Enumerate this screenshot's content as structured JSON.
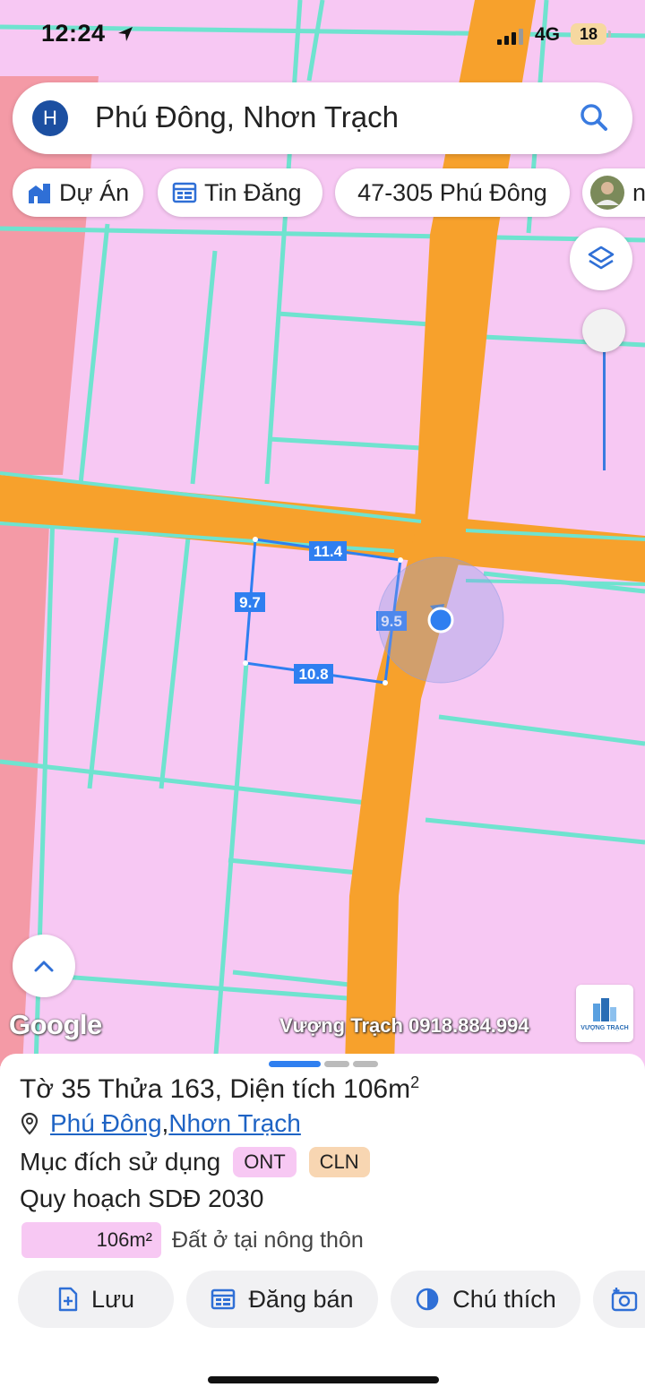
{
  "status": {
    "time": "12:24",
    "network": "4G",
    "battery": "18"
  },
  "search": {
    "avatar_letter": "H",
    "query": "Phú Đông, Nhơn Trạch"
  },
  "chips": [
    {
      "label": "Dự Án",
      "icon": "building-icon"
    },
    {
      "label": "Tin Đăng",
      "icon": "listing-icon"
    },
    {
      "label": "47-305 Phú Đông",
      "icon": ""
    },
    {
      "label": "n",
      "icon": "avatar-photo"
    }
  ],
  "map": {
    "edge_labels": [
      "11.4",
      "9.7",
      "9.5",
      "10.8"
    ],
    "google_logo": "Google",
    "watermark": "Vượng Trạch 0918.884.994",
    "watermark_logo_text": "VƯỢNG TRẠCH"
  },
  "sheet": {
    "title_prefix": "Tờ 35 Thửa 163, Diện tích 106m",
    "title_sup": "2",
    "location_ward": "Phú Đông",
    "location_sep": ", ",
    "location_district": "Nhơn Trạch",
    "purpose_label": "Mục đích sử dụng",
    "purpose_tags": [
      "ONT",
      "CLN"
    ],
    "plan_title": "Quy hoạch SDĐ 2030",
    "plan_area": "106m²",
    "plan_desc": "Đất ở tại nông thôn",
    "actions": {
      "save": "Lưu",
      "sell": "Đăng bán",
      "legend": "Chú thích"
    }
  },
  "colors": {
    "land": "#f7c8f3",
    "road": "#f7a12c",
    "boundary": "#6fe3cf",
    "parcel_outline": "#2f7ff0",
    "link": "#1e63c4",
    "tag_ont": "#f7c8f3",
    "tag_cln": "#f8d6b2"
  }
}
